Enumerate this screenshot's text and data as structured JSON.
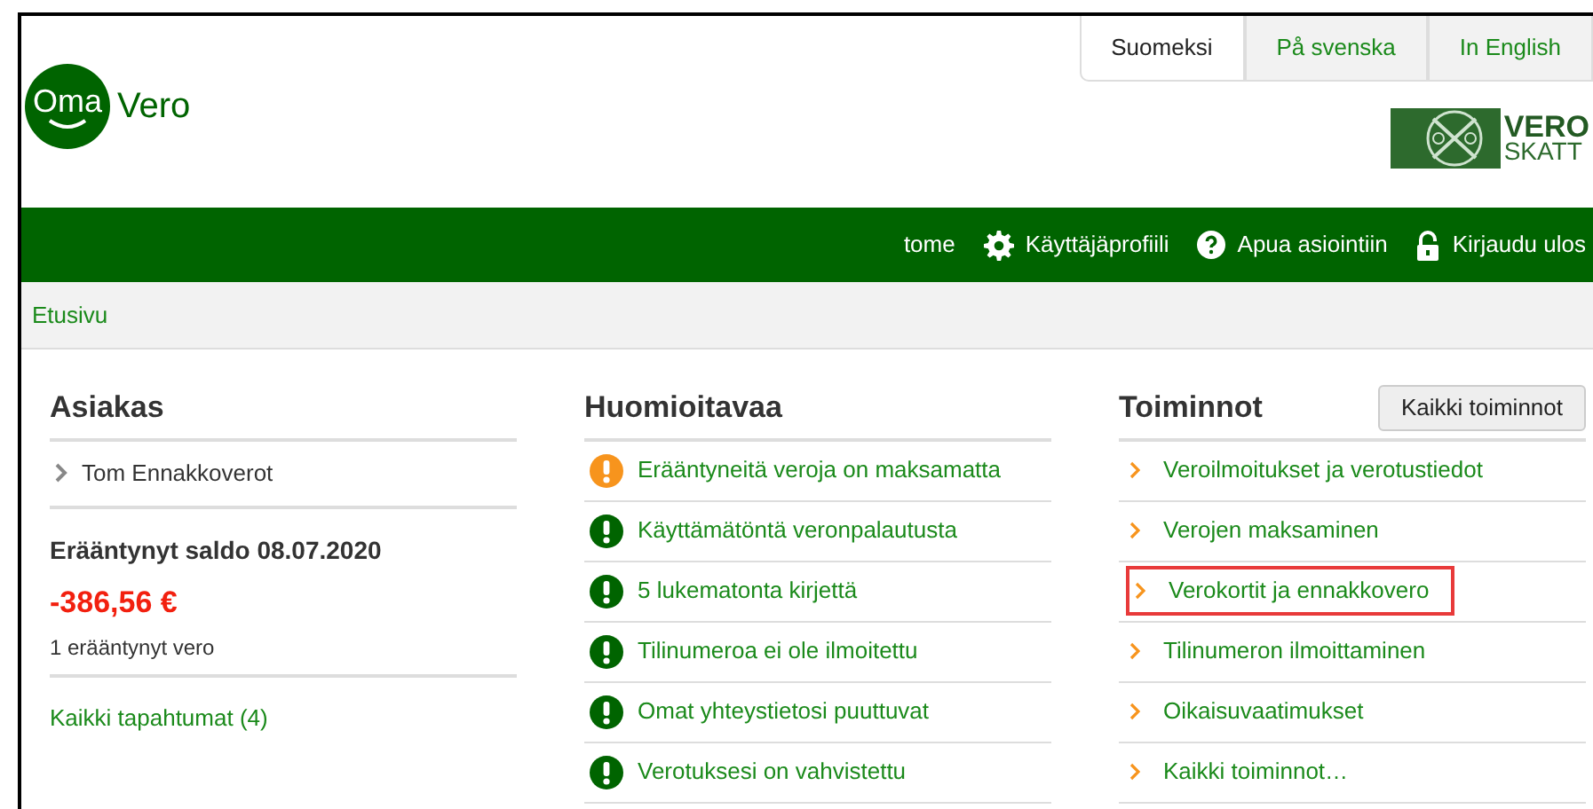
{
  "languages": [
    {
      "label": "Suomeksi",
      "selected": true
    },
    {
      "label": "På svenska",
      "selected": false
    },
    {
      "label": "In English",
      "selected": false
    }
  ],
  "logo": {
    "first": "Oma",
    "second": "Vero"
  },
  "agency_logo": {
    "line1": "VERO",
    "line2": "SKATT"
  },
  "top_nav": [
    {
      "kind": "user",
      "label": "tome"
    },
    {
      "kind": "gear",
      "label": "Käyttäjäprofiili"
    },
    {
      "kind": "help",
      "label": "Apua asiointiin"
    },
    {
      "kind": "lock",
      "label": "Kirjaudu ulos"
    }
  ],
  "breadcrumb": "Etusivu",
  "customer": {
    "title": "Asiakas",
    "name": "Tom Ennakkoverot",
    "balance_title": "Erääntynyt saldo 08.07.2020",
    "amount": "-386,56 €",
    "note": "1 erääntynyt vero",
    "link": "Kaikki tapahtumat (4)"
  },
  "notices": {
    "title": "Huomioitavaa",
    "items": [
      {
        "kind": "warning",
        "text": "Erääntyneitä veroja on maksamatta"
      },
      {
        "kind": "notice",
        "text": "Käyttämätöntä veronpalautusta"
      },
      {
        "kind": "notice",
        "text": "5 lukematonta kirjettä"
      },
      {
        "kind": "notice",
        "text": "Tilinumeroa ei ole ilmoitettu"
      },
      {
        "kind": "notice",
        "text": "Omat yhteystietosi puuttuvat"
      },
      {
        "kind": "notice",
        "text": "Verotuksesi on vahvistettu"
      }
    ]
  },
  "actions": {
    "title": "Toiminnot",
    "button": "Kaikki toiminnot",
    "items": [
      {
        "text": "Veroilmoitukset ja verotustiedot",
        "highlighted": false
      },
      {
        "text": "Verojen maksaminen",
        "highlighted": false
      },
      {
        "text": "Verokortit ja ennakkovero",
        "highlighted": true
      },
      {
        "text": "Tilinumeron ilmoittaminen",
        "highlighted": false
      },
      {
        "text": "Oikaisuvaatimukset",
        "highlighted": false
      },
      {
        "text": "Kaikki toiminnot…",
        "highlighted": false
      }
    ]
  }
}
